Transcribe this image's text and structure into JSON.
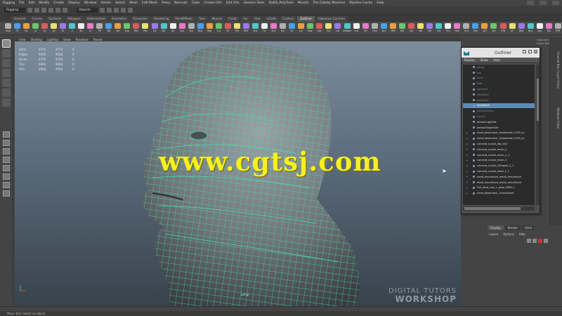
{
  "menubar": {
    "items": [
      "Rigging",
      "File",
      "Edit",
      "Modify",
      "Create",
      "Display",
      "Window",
      "Assets",
      "Select",
      "Mesh",
      "Edit Mesh",
      "Proxy",
      "Normals",
      "Color",
      "Create UVs",
      "Edit UVs",
      "Generic Tools",
      "DaDS_PolyTools",
      "Muscle",
      "The Gatsby Machine",
      "Pipeline Cache",
      "Help"
    ]
  },
  "statusline": {
    "mode": "Rigging",
    "objects_field": "Objects"
  },
  "shelf": {
    "tabs": [
      "General",
      "Curves",
      "Surfaces",
      "Polygons",
      "Deformation",
      "Animation",
      "Dynamics",
      "Rendering",
      "PaintEffects",
      "Toon",
      "Muscle",
      "Fluids",
      "Fur",
      "Hair",
      "nCloth",
      "Custom",
      "Outliner",
      "Fabulous_ConCam"
    ],
    "active_tab": "Outliner",
    "buttons": [
      "Snip",
      "P1",
      "R1",
      "L2",
      "A1",
      "A2",
      "E1",
      "V",
      "B1",
      "Lt",
      "PP",
      "BB",
      "Sel",
      "Snp",
      "Res",
      "Pos",
      "Tst",
      "FAT",
      "Scl",
      "Scp",
      "Shf",
      "Bnd",
      "Wgt",
      "Cnt",
      "Fit",
      "PRJ",
      "RBT",
      "Snp",
      "Fix",
      "Snd",
      "Eal",
      "Clr",
      "Ins",
      "Nav",
      "Abs",
      "Pnt",
      "Lbl",
      "DirtBox",
      "Lnk",
      "Eff",
      "Rnd",
      "Ren",
      "PBR",
      "Diff",
      "Cdr",
      "MB",
      "BR",
      "Dis",
      "Prv",
      "Hair",
      "Ocd",
      "Rim",
      "CRT",
      "Sht",
      "TPB",
      "XY",
      "BML",
      "Buy",
      "Cap",
      "Plb",
      "PPR"
    ],
    "icon_colors": [
      "#b0b0b0",
      "#4aa0e8",
      "#e8a040",
      "#6cc46c",
      "#d85c5c",
      "#e8e070",
      "#9a7ae8",
      "#50c8c8",
      "#f0f0f0",
      "#e87ac8"
    ]
  },
  "viewport": {
    "panel_menu": [
      "View",
      "Shading",
      "Lighting",
      "Show",
      "Renderer",
      "Panels"
    ],
    "hud": [
      {
        "label": "Verts:",
        "a": "4774",
        "b": "4774",
        "c": "0"
      },
      {
        "label": "Edges:",
        "a": "9426",
        "b": "9426",
        "c": "0"
      },
      {
        "label": "Faces:",
        "a": "4756",
        "b": "4756",
        "c": "0"
      },
      {
        "label": "Tris:",
        "a": "9464",
        "b": "9464",
        "c": "0"
      },
      {
        "label": "UVs:",
        "a": "4904",
        "b": "4904",
        "c": "0"
      }
    ],
    "camera_label": "persp",
    "watermark": "www.cgtsj.com",
    "workshop_line1": "DIGITAL TUTORS",
    "workshop_line2": "WORKSHOP"
  },
  "right_panel": {
    "title": "Channel Box / Layer Editor",
    "vertical_tabs": [
      "Channel Box / Layer Editor",
      "Attribute Editor"
    ],
    "layer_tabs": [
      "Display",
      "Render",
      "Anim"
    ],
    "layer_menu": [
      "Layers",
      "Options",
      "Help"
    ]
  },
  "outliner": {
    "title": "Outliner",
    "menu": [
      "Display",
      "Show",
      "Help"
    ],
    "rows": [
      {
        "text": "persp",
        "dim": true,
        "expand": ""
      },
      {
        "text": "top",
        "dim": true,
        "expand": ""
      },
      {
        "text": "front",
        "dim": true,
        "expand": ""
      },
      {
        "text": "side",
        "dim": true,
        "expand": ""
      },
      {
        "text": "camera1",
        "dim": true,
        "expand": ""
      },
      {
        "text": "headGrid",
        "dim": true,
        "expand": ""
      },
      {
        "text": "bodyGrid",
        "dim": true,
        "expand": ""
      },
      {
        "text": "headMesh",
        "selected": true,
        "expand": ""
      },
      {
        "text": "defaultShape",
        "dim": true,
        "expand": ""
      },
      {
        "text": "curve1",
        "dim": true,
        "expand": ""
      },
      {
        "text": "defaultLightSet",
        "expand": ""
      },
      {
        "text": "defaultObjectSet",
        "expand": ""
      },
      {
        "text": "head_basemesh_1basemesh_OOD_sc",
        "expand": "+"
      },
      {
        "text": "head_basemesh_1basemesh_OOD_sc",
        "expand": "+"
      },
      {
        "text": "concept_sculpt_obj_vol1",
        "expand": "+"
      },
      {
        "text": "concept_sculpt_mesh_1",
        "expand": "+"
      },
      {
        "text": "concept_sculpt_mesh_1_1",
        "expand": "+"
      },
      {
        "text": "concept_sculpt_mesh_1",
        "expand": "+"
      },
      {
        "text": "concept_sculpt_1Shapes_2_1",
        "expand": "+"
      },
      {
        "text": "concept_sculpt_head_1_1",
        "expand": "+"
      },
      {
        "text": "head_resurfaced_result_resurfaced",
        "expand": "+"
      },
      {
        "text": "head_resurfaced_result_resurfaced",
        "expand": "+"
      },
      {
        "text": "Full_body_low_1_pose_NEW_1",
        "expand": "+"
      },
      {
        "text": "head_basemesh_1resurfaced",
        "expand": "+"
      }
    ]
  },
  "helpline": "Move Tool: Select an object"
}
